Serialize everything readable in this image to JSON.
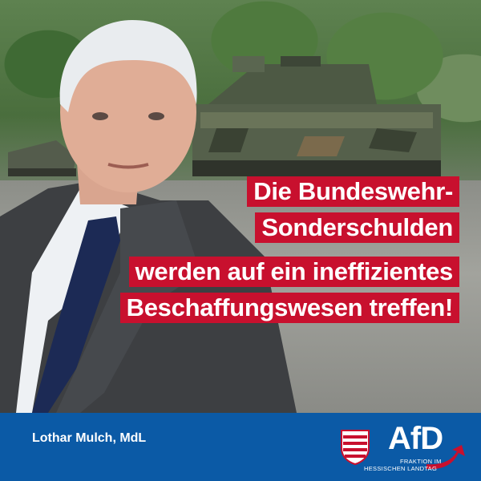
{
  "headline": {
    "lines": [
      "Die Bundeswehr-",
      "Sonderschulden",
      "werden auf ein ineffizientes",
      "Beschaffungswesen treffen!"
    ]
  },
  "footer": {
    "author": "Lothar Mulch, MdL",
    "logo_text": "AfD",
    "logo_sub1": "FRAKTION IM",
    "logo_sub2": "HESSISCHEN LANDTAG"
  },
  "colors": {
    "accent_red": "#c8102e",
    "footer_blue": "#0b5aa6"
  }
}
